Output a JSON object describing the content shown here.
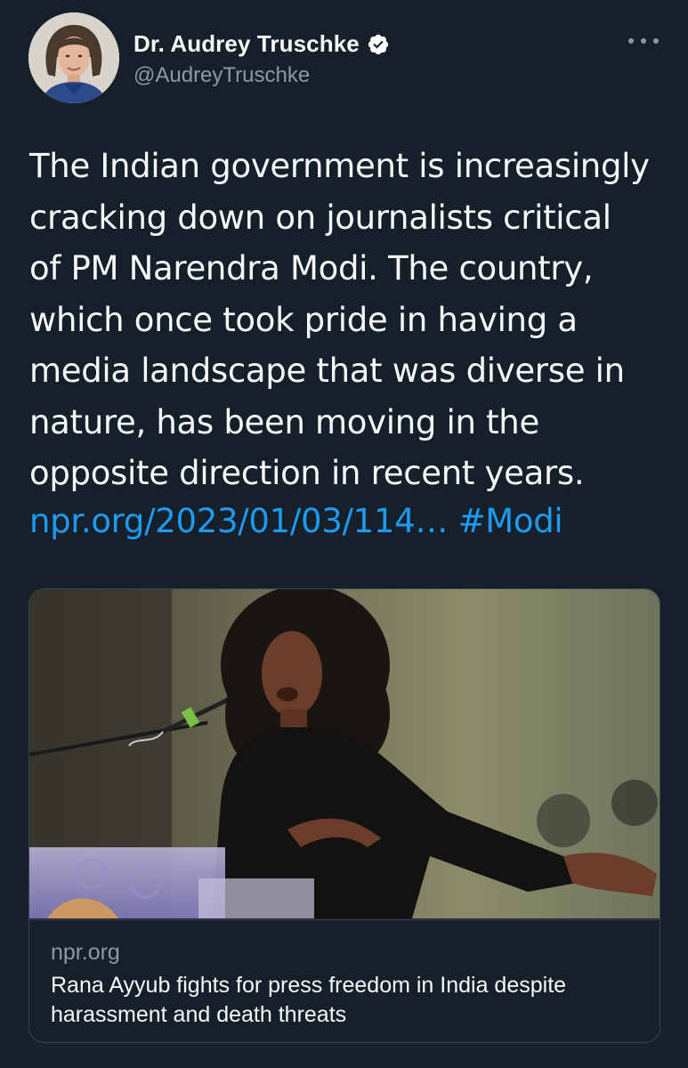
{
  "author": {
    "display_name": "Dr. Audrey Truschke",
    "handle": "@AudreyTruschke",
    "verified": true,
    "avatar_icon": "profile-photo"
  },
  "more_icon": "more-options-icon",
  "tweet": {
    "lines": [
      "The Indian government is increasingly",
      "cracking down on journalists critical",
      "of PM Narendra Modi. The country,",
      "which once took pride in having a",
      "media landscape that was diverse in",
      "nature, has been moving in the",
      "opposite direction in recent years."
    ],
    "link_text": "npr.org/2023/01/03/114…",
    "hashtag": "#Modi"
  },
  "card": {
    "domain": "npr.org",
    "title": "Rana Ayyub fights for press freedom in India despite harassment and death threats"
  },
  "colors": {
    "background": "#15202b",
    "text": "#f7f9f9",
    "secondary_text": "#8b98a5",
    "link": "#1d9bf0",
    "border": "#38444d",
    "verified_badge": "#ffffff"
  }
}
